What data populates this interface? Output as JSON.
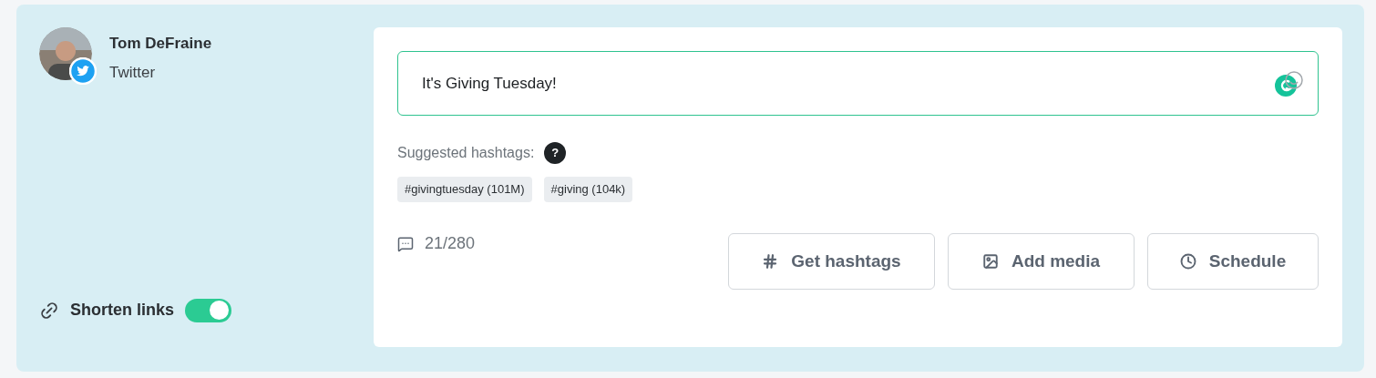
{
  "account": {
    "name": "Tom DeFraine",
    "network": "Twitter"
  },
  "post": {
    "value": "It's Giving Tuesday!"
  },
  "suggested_hashtags": {
    "label": "Suggested hashtags:",
    "help": "?",
    "tags": [
      "#givingtuesday (101M)",
      "#giving (104k)"
    ]
  },
  "char_count": "21/280",
  "buttons": [
    {
      "kind": "hashtag",
      "label": "Get hashtags"
    },
    {
      "kind": "media",
      "label": "Add media"
    },
    {
      "kind": "schedule",
      "label": "Schedule"
    }
  ],
  "shorten_links": {
    "label": "Shorten links",
    "on": true
  }
}
